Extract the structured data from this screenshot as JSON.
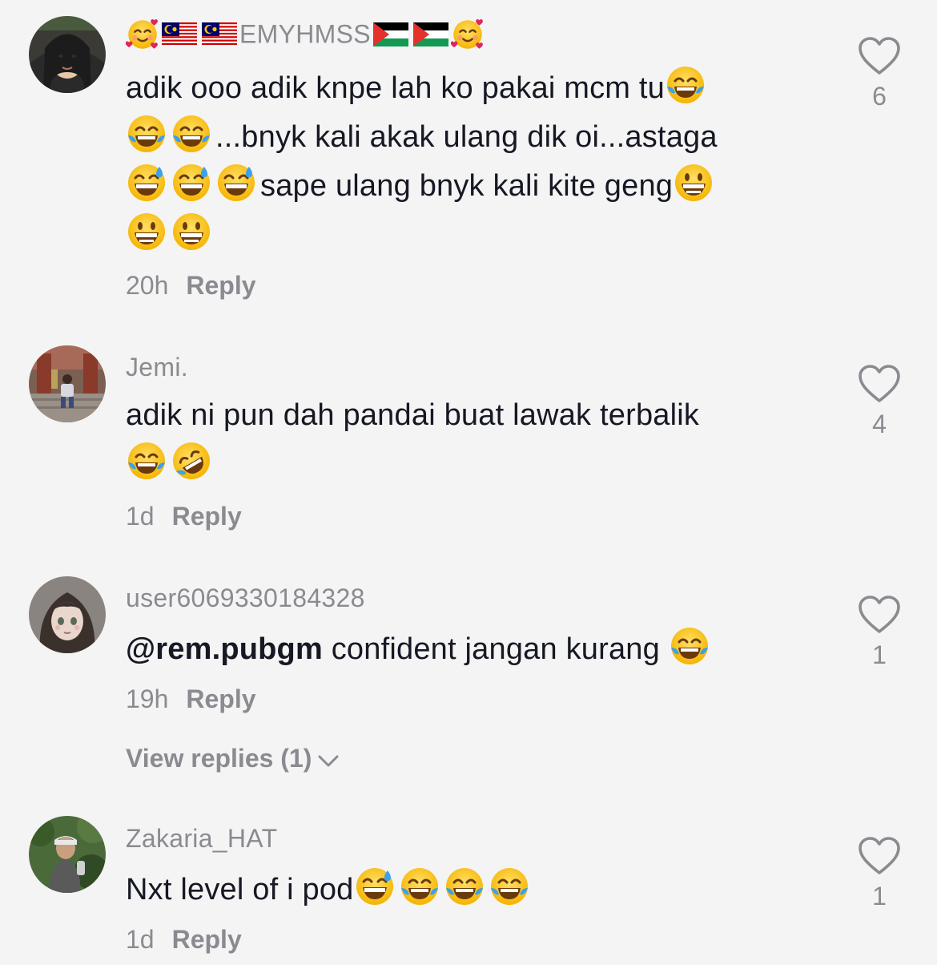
{
  "comments": [
    {
      "username": "EMYHMSS",
      "text_line1": "adik ooo adik knpe lah ko pakai mcm tu",
      "text_line2": "...bnyk kali akak ulang dik oi...astaga",
      "text_line3": "sape ulang bnyk kali kite geng",
      "time": "20h",
      "reply_label": "Reply",
      "likes": "6"
    },
    {
      "username": "Jemi.",
      "text_line1": "adik ni pun dah pandai buat lawak terbalik",
      "time": "1d",
      "reply_label": "Reply",
      "likes": "4"
    },
    {
      "username": "user6069330184328",
      "mention": "@rem.pubgm",
      "text_line1": " confident jangan kurang ",
      "time": "19h",
      "reply_label": "Reply",
      "likes": "1",
      "view_replies": "View replies (1)"
    },
    {
      "username": "Zakaria_HAT",
      "text_line1": "Nxt level of i pod",
      "time": "1d",
      "reply_label": "Reply",
      "likes": "1"
    }
  ],
  "colors": {
    "background": "#f4f4f4",
    "text": "#161823",
    "muted": "#8a8b91"
  },
  "icons": {
    "like": "heart-outline-icon",
    "expand": "chevron-down-icon"
  }
}
